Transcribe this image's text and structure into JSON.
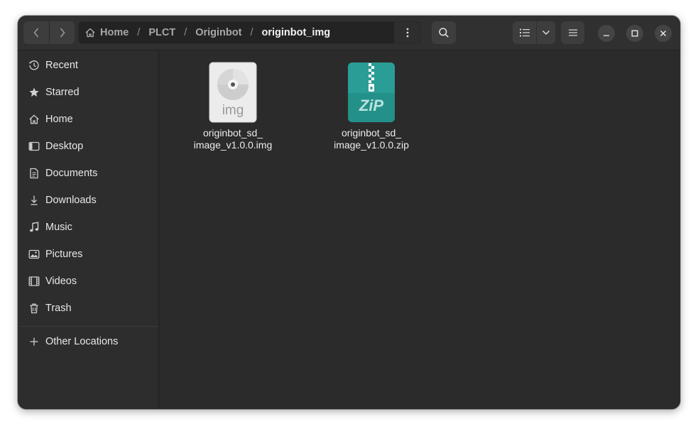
{
  "breadcrumb": [
    {
      "label": "Home",
      "current": false
    },
    {
      "label": "PLCT",
      "current": false
    },
    {
      "label": "Originbot",
      "current": false
    },
    {
      "label": "originbot_img",
      "current": true
    }
  ],
  "breadcrumb_separator": "/",
  "sidebar": {
    "items": [
      {
        "label": "Recent",
        "icon": "clock-icon"
      },
      {
        "label": "Starred",
        "icon": "star-icon"
      },
      {
        "label": "Home",
        "icon": "home-icon"
      },
      {
        "label": "Desktop",
        "icon": "desktop-icon"
      },
      {
        "label": "Documents",
        "icon": "document-icon"
      },
      {
        "label": "Downloads",
        "icon": "download-icon"
      },
      {
        "label": "Music",
        "icon": "music-icon"
      },
      {
        "label": "Pictures",
        "icon": "picture-icon"
      },
      {
        "label": "Videos",
        "icon": "video-icon"
      },
      {
        "label": "Trash",
        "icon": "trash-icon"
      }
    ],
    "other_locations": {
      "label": "Other Locations",
      "icon": "plus-icon"
    }
  },
  "files": [
    {
      "name_line1": "originbot_sd_",
      "name_line2": "image_v1.0.0.img",
      "icon": "disc-image-icon",
      "icon_text": "img"
    },
    {
      "name_line1": "originbot_sd_",
      "name_line2": "image_v1.0.0.zip",
      "icon": "zip-archive-icon",
      "icon_text": "ZiP"
    }
  ],
  "colors": {
    "window_bg": "#2b2b2b",
    "headerbar_bg": "#303030",
    "zip_teal": "#2a9d96"
  }
}
